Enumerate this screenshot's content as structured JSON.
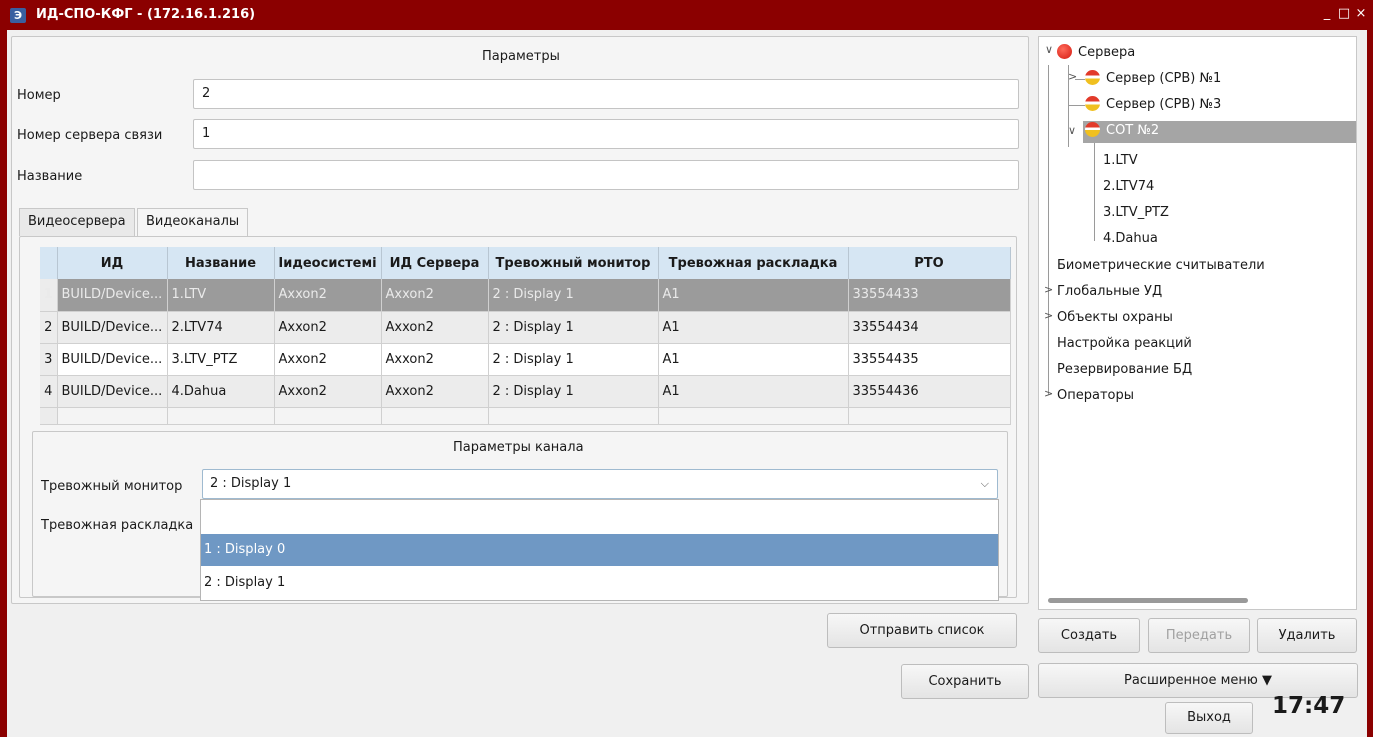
{
  "window": {
    "title": "ИД-СПО-КФГ -  (172.16.1.216)",
    "app_icon": "app-logo-icon",
    "minimize_label": "_",
    "maximize_label": "□",
    "close_label": "×"
  },
  "params": {
    "header": "Параметры",
    "fields": [
      {
        "label": "Номер",
        "value": "2"
      },
      {
        "label": "Номер сервера связи",
        "value": "1"
      },
      {
        "label": "Название",
        "value": ""
      }
    ]
  },
  "tabs": [
    {
      "label": "Видеосервера",
      "active": false
    },
    {
      "label": "Видеоканалы",
      "active": true
    }
  ],
  "table": {
    "columns": [
      "ИД",
      "Название",
      "Іидеосистемі",
      "ИД Сервера",
      "Тревожный монитор",
      "Тревожная раскладка",
      "РТО"
    ],
    "rows": [
      {
        "num": "1",
        "cells": [
          "BUILD/Device...",
          "1.LTV",
          "Axxon2",
          "Axxon2",
          "2 : Display 1",
          "A1",
          "33554433"
        ],
        "selected": true
      },
      {
        "num": "2",
        "cells": [
          "BUILD/Device...",
          "2.LTV74",
          "Axxon2",
          "Axxon2",
          "2 : Display 1",
          "A1",
          "33554434"
        ],
        "selected": false
      },
      {
        "num": "3",
        "cells": [
          "BUILD/Device...",
          "3.LTV_PTZ",
          "Axxon2",
          "Axxon2",
          "2 : Display 1",
          "A1",
          "33554435"
        ],
        "selected": false
      },
      {
        "num": "4",
        "cells": [
          "BUILD/Device...",
          "4.Dahua",
          "Axxon2",
          "Axxon2",
          "2 : Display 1",
          "A1",
          "33554436"
        ],
        "selected": false
      }
    ]
  },
  "channel": {
    "header": "Параметры канала",
    "alarm_monitor_label": "Тревожный монитор",
    "alarm_monitor_value": "2 : Display 1",
    "alarm_layout_label": "Тревожная раскладка",
    "dropdown_options": [
      "",
      "1 : Display 0",
      "2 : Display 1"
    ],
    "dropdown_highlighted": "1 : Display 0"
  },
  "buttons": {
    "send_list": "Отправить список",
    "save": "Сохранить",
    "create": "Создать",
    "transfer": "Передать",
    "delete": "Удалить",
    "advanced_menu": "Расширенное меню ▼",
    "exit": "Выход"
  },
  "tree": {
    "root": "Сервера",
    "servers": [
      "Сервер (СРВ) №1",
      "Сервер (СРВ) №3",
      "СОТ №2"
    ],
    "channels": [
      "1.LTV",
      "2.LTV74",
      "3.LTV_PTZ",
      "4.Dahua"
    ],
    "other": [
      "Биометрические считыватели",
      "Глобальные УД",
      "Объекты охраны",
      "Настройка реакций",
      "Резервирование БД",
      "Операторы"
    ]
  },
  "clock": "17:47",
  "colors": {
    "frame": "#8b0000",
    "header_row": "#d6e6f3",
    "selected_row": "#9b9b9b",
    "highlight": "#6f98c4"
  }
}
